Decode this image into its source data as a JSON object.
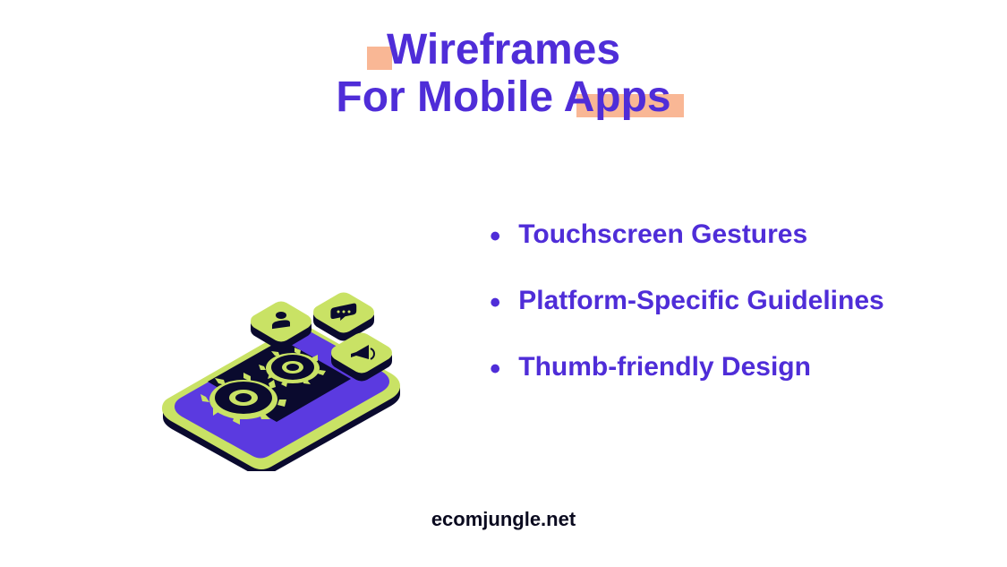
{
  "header": {
    "title_line_1": "Wireframes",
    "title_line_2": "For Mobile Apps"
  },
  "bullets": {
    "item_1": "Touchscreen Gestures",
    "item_2": "Platform-Specific Guidelines",
    "item_3": "Thumb-friendly Design"
  },
  "footer": {
    "site": "ecomjungle.net"
  },
  "colors": {
    "primary": "#4f2dd8",
    "accent_highlight": "#f9b795",
    "phone_body": "#5b3ae0",
    "phone_dark": "#0a0a2e",
    "phone_green": "#c9e265"
  }
}
